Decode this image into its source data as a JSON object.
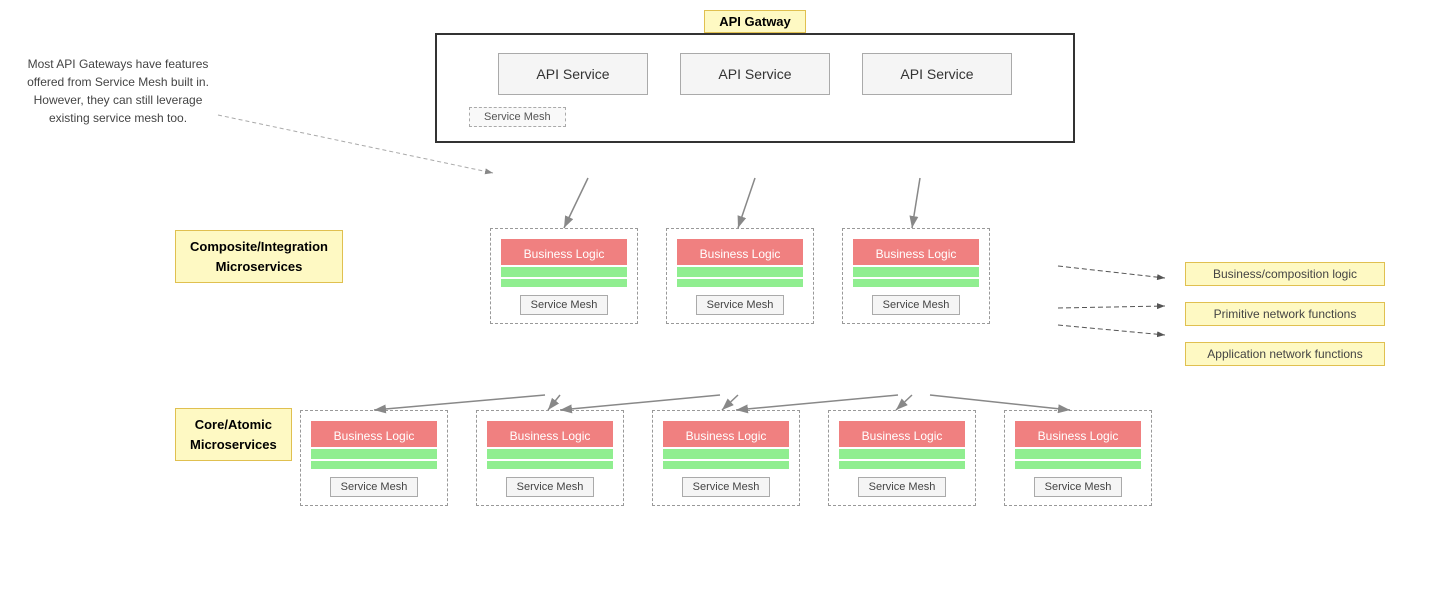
{
  "apiGateway": {
    "label": "API Gatway",
    "services": [
      "API Service",
      "API Service",
      "API Service"
    ],
    "serviceMesh": "Service Mesh"
  },
  "annotation": {
    "text": "Most API Gateways have features offered from Service Mesh built in. However, they can still leverage existing service mesh too."
  },
  "composite": {
    "label": "Composite/Integration\nMicroservices",
    "boxes": [
      {
        "businessLogic": "Business Logic",
        "serviceMesh": "Service Mesh"
      },
      {
        "businessLogic": "Business Logic",
        "serviceMesh": "Service Mesh"
      },
      {
        "businessLogic": "Business Logic",
        "serviceMesh": "Service Mesh"
      }
    ]
  },
  "core": {
    "label": "Core/Atomic\nMicroservices",
    "boxes": [
      {
        "businessLogic": "Business Logic",
        "serviceMesh": "Service Mesh"
      },
      {
        "businessLogic": "Business Logic",
        "serviceMesh": "Service Mesh"
      },
      {
        "businessLogic": "Business Logic",
        "serviceMesh": "Service Mesh"
      },
      {
        "businessLogic": "Business Logic",
        "serviceMesh": "Service Mesh"
      },
      {
        "businessLogic": "Business Logic",
        "serviceMesh": "Service Mesh"
      }
    ]
  },
  "rightAnnotations": [
    "Business/composition logic",
    "Primitive network functions",
    "Application network functions"
  ],
  "colors": {
    "businessLogic": "#f08080",
    "primitive": "#90ee90",
    "app": "#90ee90",
    "labelBg": "#fef9c3",
    "labelBorder": "#e0c050"
  }
}
